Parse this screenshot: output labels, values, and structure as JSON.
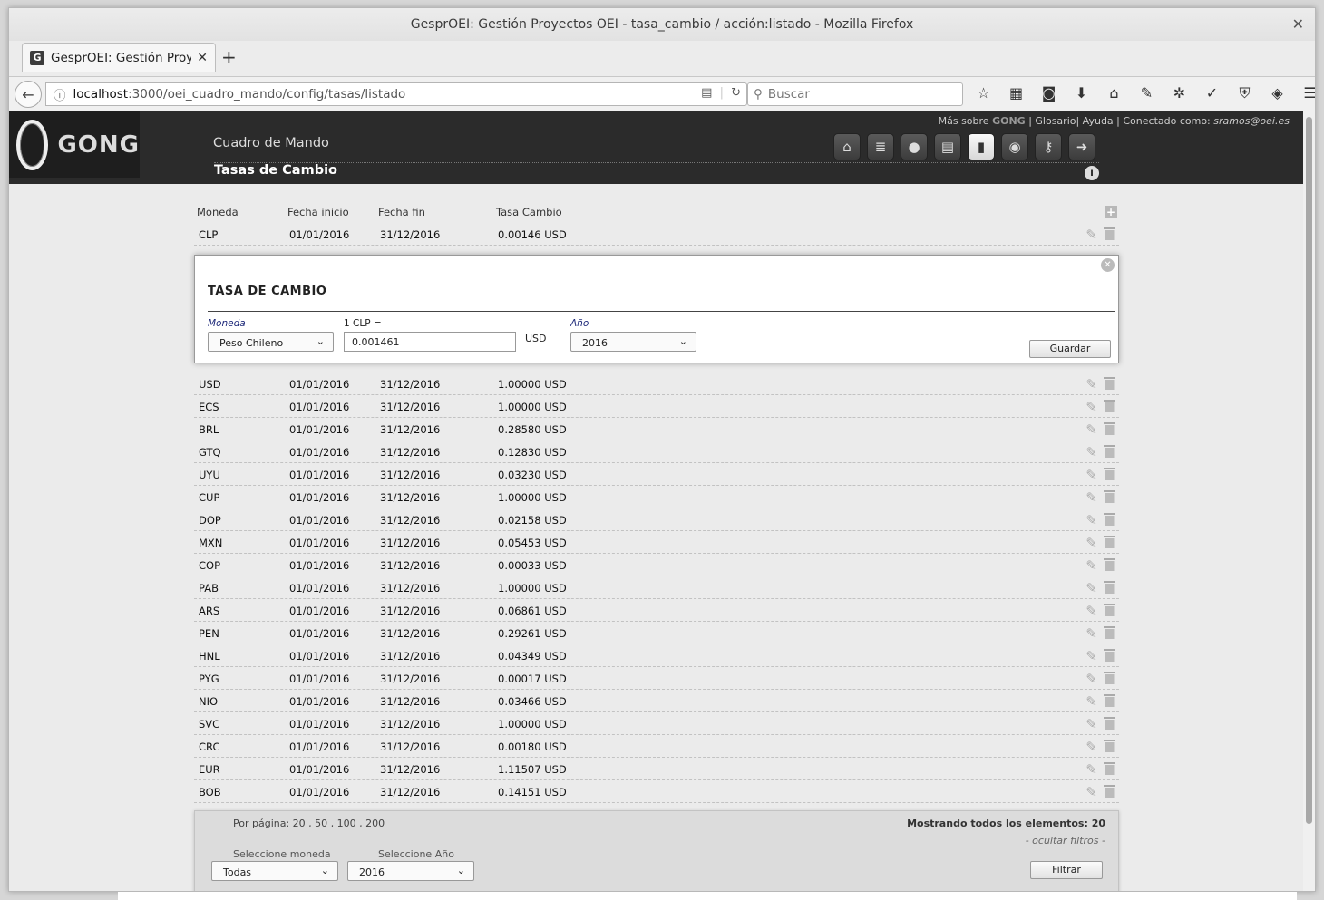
{
  "window": {
    "title": "GesprOEI: Gestión Proyectos OEI - tasa_cambio / acción:listado - Mozilla Firefox",
    "tab_title": "GesprOEI: Gestión Proy",
    "url_host": "localhost",
    "url_path": ":3000/oei_cuadro_mando/config/tasas/listado",
    "search_placeholder": "Buscar"
  },
  "app": {
    "logo_text": "GONG",
    "section_title": "Cuadro de Mando",
    "subsection_title": "Tasas de Cambio",
    "topnav": {
      "mas_sobre": "Más sobre",
      "gong": "GONG",
      "glosario": "| Glosario",
      "ayuda": "| Ayuda",
      "conectado": "| Conectado como:",
      "user": "sramos@oei.es"
    },
    "module_icons": [
      "home-icon",
      "database-icon",
      "user-icon",
      "layers-icon",
      "chart-icon",
      "users-icon",
      "key-icon",
      "exit-icon"
    ]
  },
  "table": {
    "headers": {
      "moneda": "Moneda",
      "inicio": "Fecha inicio",
      "fin": "Fecha fin",
      "tasa": "Tasa Cambio"
    },
    "first_row": {
      "moneda": "CLP",
      "inicio": "01/01/2016",
      "fin": "31/12/2016",
      "tasa": "0.00146 USD"
    },
    "rows": [
      {
        "moneda": "USD",
        "inicio": "01/01/2016",
        "fin": "31/12/2016",
        "tasa": "1.00000 USD"
      },
      {
        "moneda": "ECS",
        "inicio": "01/01/2016",
        "fin": "31/12/2016",
        "tasa": "1.00000 USD"
      },
      {
        "moneda": "BRL",
        "inicio": "01/01/2016",
        "fin": "31/12/2016",
        "tasa": "0.28580 USD"
      },
      {
        "moneda": "GTQ",
        "inicio": "01/01/2016",
        "fin": "31/12/2016",
        "tasa": "0.12830 USD"
      },
      {
        "moneda": "UYU",
        "inicio": "01/01/2016",
        "fin": "31/12/2016",
        "tasa": "0.03230 USD"
      },
      {
        "moneda": "CUP",
        "inicio": "01/01/2016",
        "fin": "31/12/2016",
        "tasa": "1.00000 USD"
      },
      {
        "moneda": "DOP",
        "inicio": "01/01/2016",
        "fin": "31/12/2016",
        "tasa": "0.02158 USD"
      },
      {
        "moneda": "MXN",
        "inicio": "01/01/2016",
        "fin": "31/12/2016",
        "tasa": "0.05453 USD"
      },
      {
        "moneda": "COP",
        "inicio": "01/01/2016",
        "fin": "31/12/2016",
        "tasa": "0.00033 USD"
      },
      {
        "moneda": "PAB",
        "inicio": "01/01/2016",
        "fin": "31/12/2016",
        "tasa": "1.00000 USD"
      },
      {
        "moneda": "ARS",
        "inicio": "01/01/2016",
        "fin": "31/12/2016",
        "tasa": "0.06861 USD"
      },
      {
        "moneda": "PEN",
        "inicio": "01/01/2016",
        "fin": "31/12/2016",
        "tasa": "0.29261 USD"
      },
      {
        "moneda": "HNL",
        "inicio": "01/01/2016",
        "fin": "31/12/2016",
        "tasa": "0.04349 USD"
      },
      {
        "moneda": "PYG",
        "inicio": "01/01/2016",
        "fin": "31/12/2016",
        "tasa": "0.00017 USD"
      },
      {
        "moneda": "NIO",
        "inicio": "01/01/2016",
        "fin": "31/12/2016",
        "tasa": "0.03466 USD"
      },
      {
        "moneda": "SVC",
        "inicio": "01/01/2016",
        "fin": "31/12/2016",
        "tasa": "1.00000 USD"
      },
      {
        "moneda": "CRC",
        "inicio": "01/01/2016",
        "fin": "31/12/2016",
        "tasa": "0.00180 USD"
      },
      {
        "moneda": "EUR",
        "inicio": "01/01/2016",
        "fin": "31/12/2016",
        "tasa": "1.11507 USD"
      },
      {
        "moneda": "BOB",
        "inicio": "01/01/2016",
        "fin": "31/12/2016",
        "tasa": "0.14151 USD"
      }
    ]
  },
  "edit_panel": {
    "title": "TASA DE CAMBIO",
    "moneda_label": "Moneda",
    "moneda_value": "Peso Chileno",
    "rate_label": "1 CLP =",
    "rate_value": "0.001461",
    "rate_unit": "USD",
    "anio_label": "Año",
    "anio_value": "2016",
    "save_label": "Guardar"
  },
  "filter_panel": {
    "per_page": "Por página: 20 , 50 , 100 , 200",
    "showing": "Mostrando todos  los elementos: 20",
    "hide_filters": "- ocultar filtros -",
    "moneda_label": "Seleccione moneda",
    "moneda_value": "Todas",
    "anio_label": "Seleccione Año",
    "anio_value": "2016",
    "filter_button": "Filtrar"
  }
}
